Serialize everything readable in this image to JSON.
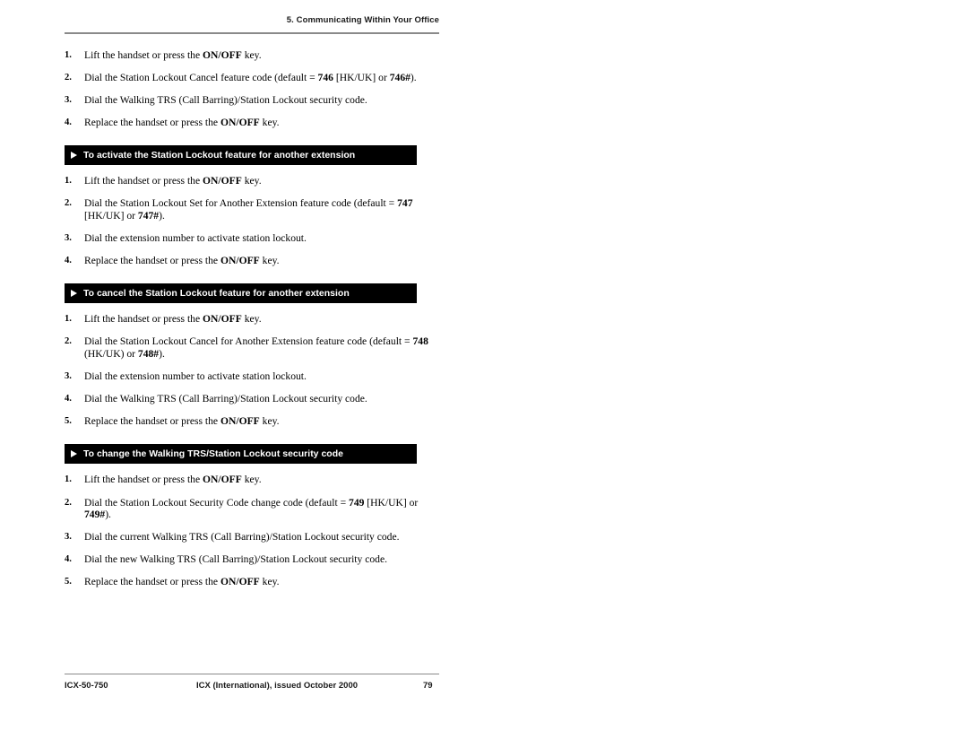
{
  "header": {
    "chapter_title": "5. Communicating Within Your Office"
  },
  "sections": [
    {
      "banner": null,
      "steps": [
        {
          "num": "1.",
          "html": "Lift the handset or press the <b>ON/OFF</b> key."
        },
        {
          "num": "2.",
          "html": "Dial the Station Lockout Cancel feature code (default = <b>746</b> [HK/UK] or <b>746#</b>)."
        },
        {
          "num": "3.",
          "html": "Dial the Walking TRS (Call Barring)/Station Lockout security code."
        },
        {
          "num": "4.",
          "html": "Replace the handset or press the <b>ON/OFF</b> key."
        }
      ]
    },
    {
      "banner": "To activate the Station Lockout feature for another extension",
      "steps": [
        {
          "num": "1.",
          "html": "Lift the handset or press the <b>ON/OFF</b> key."
        },
        {
          "num": "2.",
          "html": "Dial the Station Lockout Set for Another Extension feature code (default = <b>747</b> [HK/UK] or <b>747#</b>)."
        },
        {
          "num": "3.",
          "html": "Dial the extension number to activate station lockout."
        },
        {
          "num": "4.",
          "html": "Replace the handset or press the <b>ON/OFF</b> key."
        }
      ]
    },
    {
      "banner": "To cancel the Station Lockout feature for another extension",
      "steps": [
        {
          "num": "1.",
          "html": "Lift the handset or press the <b>ON/OFF</b> key."
        },
        {
          "num": "2.",
          "html": "Dial the Station Lockout Cancel for Another Extension feature code (default = <b>748</b> (HK/UK) or <b>748#</b>)."
        },
        {
          "num": "3.",
          "html": "Dial the extension number to activate station lockout."
        },
        {
          "num": "4.",
          "html": "Dial the Walking TRS (Call Barring)/Station Lockout security code."
        },
        {
          "num": "5.",
          "html": "Replace the handset or press the <b>ON/OFF</b> key."
        }
      ]
    },
    {
      "banner": "To change the Walking TRS/Station Lockout security code",
      "steps": [
        {
          "num": "1.",
          "html": "Lift the handset or press the <b>ON/OFF</b> key."
        },
        {
          "num": "2.",
          "html": "Dial the Station Lockout Security Code change code (default = <b>749</b> [HK/UK] or <b>749#</b>)."
        },
        {
          "num": "3.",
          "html": "Dial the current Walking TRS (Call Barring)/Station Lockout security code."
        },
        {
          "num": "4.",
          "html": "Dial the new Walking TRS (Call Barring)/Station Lockout security code."
        },
        {
          "num": "5.",
          "html": "Replace the handset or press the <b>ON/OFF</b> key."
        }
      ]
    }
  ],
  "footer": {
    "document_number": "ICX-50-750",
    "edition": "ICX (International), issued October 2000",
    "page_number": "79"
  }
}
